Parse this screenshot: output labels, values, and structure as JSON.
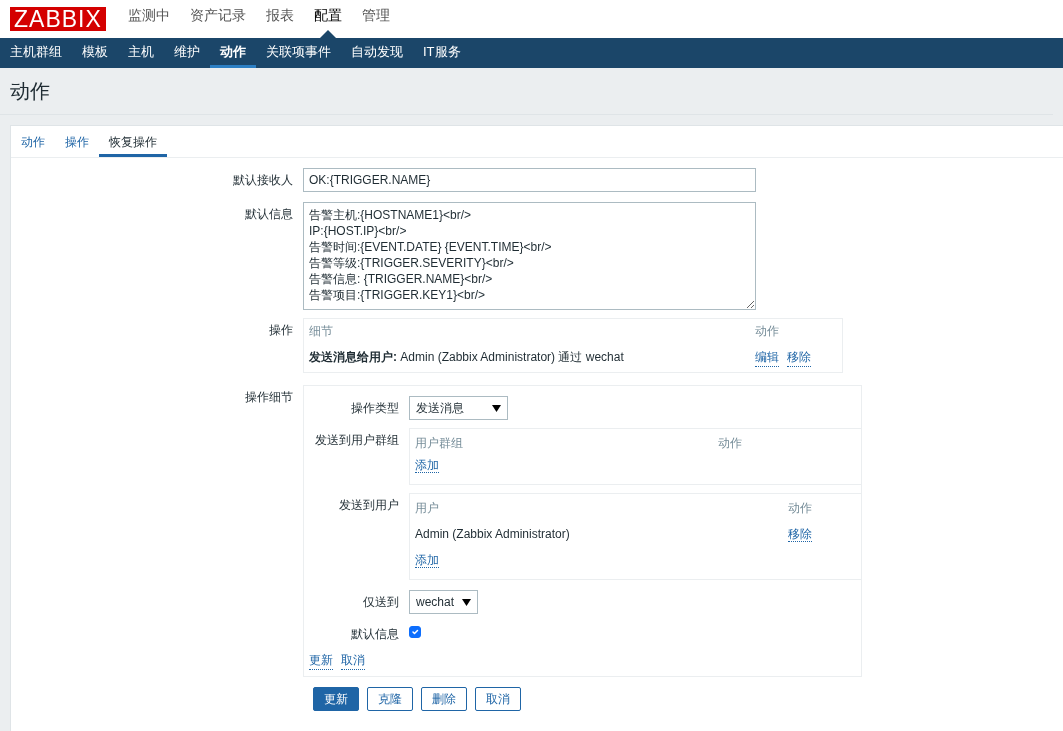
{
  "logo": "ZABBIX",
  "main_menu": [
    {
      "label": "监测中",
      "selected": false
    },
    {
      "label": "资产记录",
      "selected": false
    },
    {
      "label": "报表",
      "selected": false
    },
    {
      "label": "配置",
      "selected": true
    },
    {
      "label": "管理",
      "selected": false
    }
  ],
  "sub_menu": [
    {
      "label": "主机群组",
      "selected": false
    },
    {
      "label": "模板",
      "selected": false
    },
    {
      "label": "主机",
      "selected": false
    },
    {
      "label": "维护",
      "selected": false
    },
    {
      "label": "动作",
      "selected": true
    },
    {
      "label": "关联项事件",
      "selected": false
    },
    {
      "label": "自动发现",
      "selected": false
    },
    {
      "label": "IT服务",
      "selected": false
    }
  ],
  "page_title": "动作",
  "tabs": [
    {
      "label": "动作",
      "selected": false
    },
    {
      "label": "操作",
      "selected": false
    },
    {
      "label": "恢复操作",
      "selected": true
    }
  ],
  "form": {
    "recovery_subject": {
      "label": "默认接收人",
      "value": "OK:{TRIGGER.NAME}"
    },
    "recovery_message": {
      "label": "默认信息",
      "lines": [
        "告警主机:{HOSTNAME1}<br/>",
        "IP:{HOST.IP}<br/>",
        "告警时间:{EVENT.DATE} {EVENT.TIME}<br/>",
        "告警等级:{TRIGGER.SEVERITY}<br/>",
        "告警信息: {TRIGGER.NAME}<br/>",
        "告警项目:{TRIGGER.KEY1}<br/>"
      ]
    },
    "operations": {
      "label": "操作",
      "columns": [
        "细节",
        "动作"
      ],
      "rows": [
        {
          "details": "**发送消息给用户:** Admin (Zabbix Administrator) 通过 wechat",
          "actions": [
            "编辑",
            "移除"
          ]
        }
      ]
    },
    "operation_details": {
      "label": "操作细节",
      "operation_type": {
        "label": "操作类型",
        "value": "发送消息"
      },
      "user_groups": {
        "label": "发送到用户群组",
        "columns": [
          "用户群组",
          "动作"
        ],
        "add": "添加"
      },
      "users": {
        "label": "发送到用户",
        "columns": [
          "用户",
          "动作"
        ],
        "rows": [
          {
            "name": "Admin (Zabbix Administrator)",
            "action": "移除"
          }
        ],
        "add": "添加"
      },
      "send_only_to": {
        "label": "仅送到",
        "value": "wechat"
      },
      "default_message": {
        "label": "默认信息",
        "checked": true
      },
      "links": [
        "更新",
        "取消"
      ]
    }
  },
  "buttons": [
    {
      "label": "更新",
      "primary": true
    },
    {
      "label": "克隆",
      "primary": false
    },
    {
      "label": "删除",
      "primary": false
    },
    {
      "label": "取消",
      "primary": false
    }
  ]
}
